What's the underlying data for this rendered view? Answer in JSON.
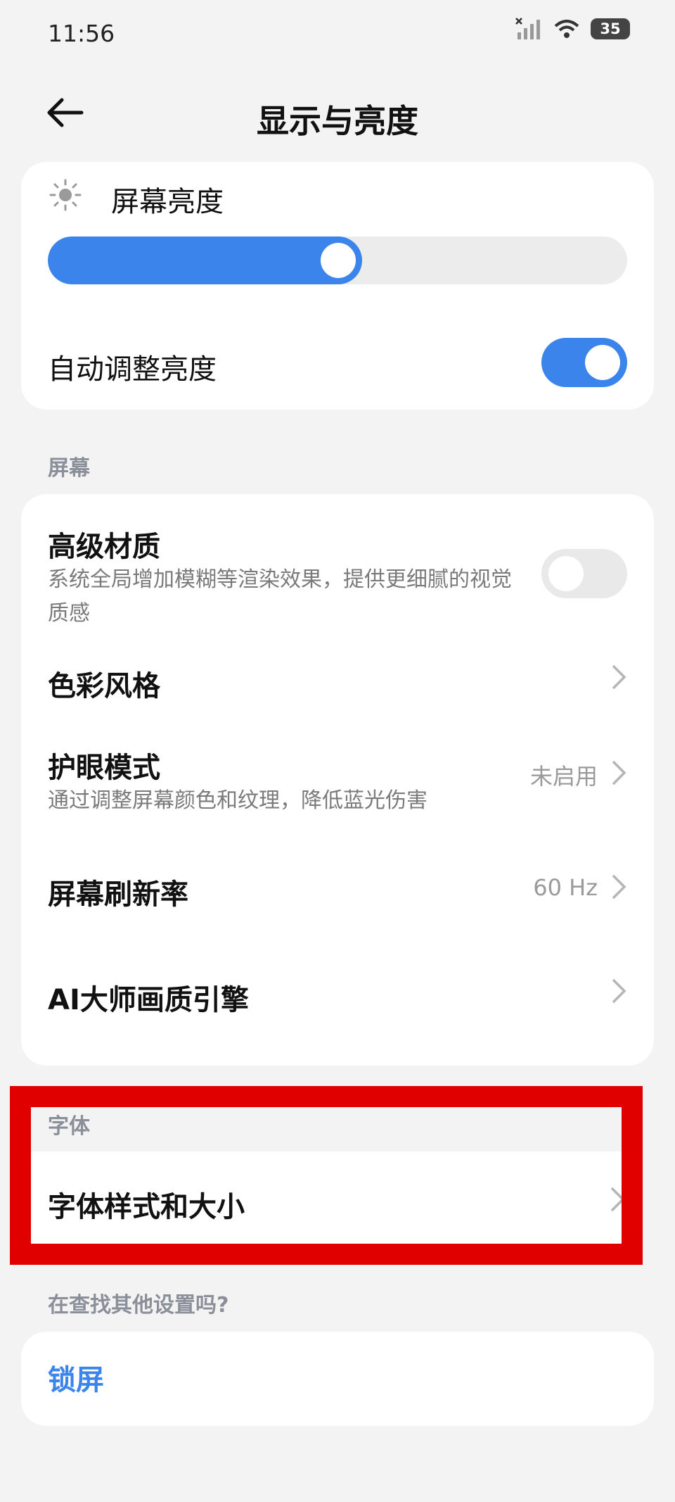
{
  "status_bar": {
    "time": "11:56",
    "battery": "35",
    "icons": [
      "signal-off-icon",
      "wifi-icon",
      "battery-icon"
    ]
  },
  "header": {
    "title": "显示与亮度",
    "back_icon": "back-arrow-icon"
  },
  "brightness": {
    "label": "屏幕亮度",
    "icon": "sun-icon",
    "level_fraction": 0.53,
    "accent_color": "#3a84ec"
  },
  "auto_brightness": {
    "label": "自动调整亮度",
    "enabled": true
  },
  "screen_section": {
    "label": "屏幕",
    "items": [
      {
        "title": "高级材质",
        "subtitle": "系统全局增加模糊等渲染效果，提供更细腻的视觉质感",
        "control": "toggle",
        "enabled": false
      },
      {
        "title": "色彩风格",
        "control": "chevron"
      },
      {
        "title": "护眼模式",
        "subtitle": "通过调整屏幕颜色和纹理，降低蓝光伤害",
        "value": "未启用",
        "control": "chevron"
      },
      {
        "title": "屏幕刷新率",
        "value": "60 Hz",
        "control": "chevron"
      },
      {
        "title": "AI大师画质引擎",
        "control": "chevron"
      }
    ]
  },
  "font_section": {
    "label": "字体",
    "items": [
      {
        "title": "字体样式和大小",
        "control": "chevron"
      }
    ]
  },
  "other_section": {
    "label": "在查找其他设置吗?",
    "items": [
      {
        "title": "锁屏"
      }
    ]
  },
  "highlight_color": "#e00000"
}
